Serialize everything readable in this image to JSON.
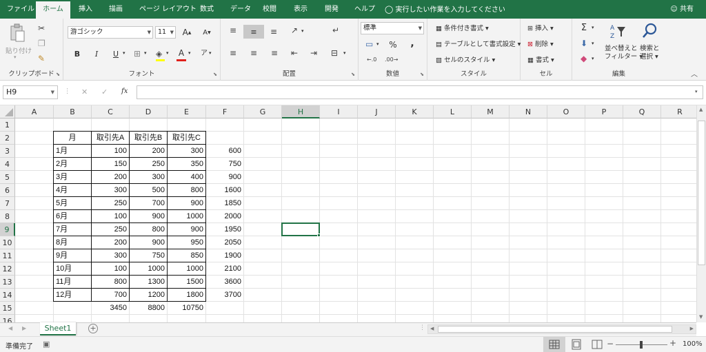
{
  "tabs": [
    "ファイル",
    "ホーム",
    "挿入",
    "描画",
    "ページ レイアウト",
    "数式",
    "データ",
    "校閲",
    "表示",
    "開発",
    "ヘルプ"
  ],
  "active_tab": "ホーム",
  "tell_me": "実行したい作業を入力してください",
  "share": "共有",
  "ribbon": {
    "clipboard": {
      "label": "クリップボード",
      "paste": "貼り付け"
    },
    "font": {
      "label": "フォント",
      "font_name": "游ゴシック",
      "font_size": "11",
      "bold": "B",
      "italic": "I",
      "underline": "U",
      "grow": "A",
      "shrink": "A",
      "font_color_glyph": "A"
    },
    "alignment": {
      "label": "配置"
    },
    "number": {
      "label": "数値",
      "format": "標準",
      "percent": "%",
      "comma": ","
    },
    "styles": {
      "label": "スタイル",
      "conditional": "条件付き書式",
      "as_table": "テーブルとして書式設定",
      "cell_styles": "セルのスタイル"
    },
    "cells": {
      "label": "セル",
      "insert": "挿入",
      "delete": "削除",
      "format": "書式"
    },
    "editing": {
      "label": "編集",
      "sum": "Σ",
      "sort_l1": "並べ替えと",
      "sort_l2": "フィルター",
      "find_l1": "検索と",
      "find_l2": "選択"
    }
  },
  "formula_bar": {
    "name_box": "H9",
    "fx": "fx",
    "cancel": "✕",
    "enter": "✓",
    "formula": ""
  },
  "columns": [
    "A",
    "B",
    "C",
    "D",
    "E",
    "F",
    "G",
    "H",
    "I",
    "J",
    "K",
    "L",
    "M",
    "N",
    "O",
    "P",
    "Q",
    "R"
  ],
  "rows": [
    "1",
    "2",
    "3",
    "4",
    "5",
    "6",
    "7",
    "8",
    "9",
    "10",
    "11",
    "12",
    "13",
    "14",
    "15",
    "16"
  ],
  "table_headers": [
    "月",
    "取引先A",
    "取引先B",
    "取引先C"
  ],
  "table_rows": [
    {
      "month": "1月",
      "a": "100",
      "b": "200",
      "c": "300",
      "f": "600"
    },
    {
      "month": "2月",
      "a": "150",
      "b": "250",
      "c": "350",
      "f": "750"
    },
    {
      "month": "3月",
      "a": "200",
      "b": "300",
      "c": "400",
      "f": "900"
    },
    {
      "month": "4月",
      "a": "300",
      "b": "500",
      "c": "800",
      "f": "1600"
    },
    {
      "month": "5月",
      "a": "250",
      "b": "700",
      "c": "900",
      "f": "1850"
    },
    {
      "month": "6月",
      "a": "100",
      "b": "900",
      "c": "1000",
      "f": "2000"
    },
    {
      "month": "7月",
      "a": "250",
      "b": "800",
      "c": "900",
      "f": "1950"
    },
    {
      "month": "8月",
      "a": "200",
      "b": "900",
      "c": "950",
      "f": "2050"
    },
    {
      "month": "9月",
      "a": "300",
      "b": "750",
      "c": "850",
      "f": "1900"
    },
    {
      "month": "10月",
      "a": "100",
      "b": "1000",
      "c": "1000",
      "f": "2100"
    },
    {
      "month": "11月",
      "a": "800",
      "b": "1300",
      "c": "1500",
      "f": "3600"
    },
    {
      "month": "12月",
      "a": "700",
      "b": "1200",
      "c": "1800",
      "f": "3700"
    }
  ],
  "totals": {
    "a": "3450",
    "b": "8800",
    "c": "10750"
  },
  "active_cell": {
    "col": "H",
    "row": "9"
  },
  "sheet_tab": "Sheet1",
  "status": {
    "ready": "準備完了",
    "zoom": "100%"
  },
  "colors": {
    "excel_green": "#217346",
    "font_color_bar": "#e0201b"
  },
  "icons": [
    "paste-icon",
    "cut-icon",
    "copy-icon",
    "format-painter-icon",
    "borders-icon",
    "fill-color-icon",
    "font-color-icon",
    "lightbulb-icon",
    "user-icon",
    "sort-filter-icon",
    "find-icon",
    "sum-icon",
    "normal-view-icon",
    "page-layout-view-icon",
    "page-break-view-icon"
  ]
}
